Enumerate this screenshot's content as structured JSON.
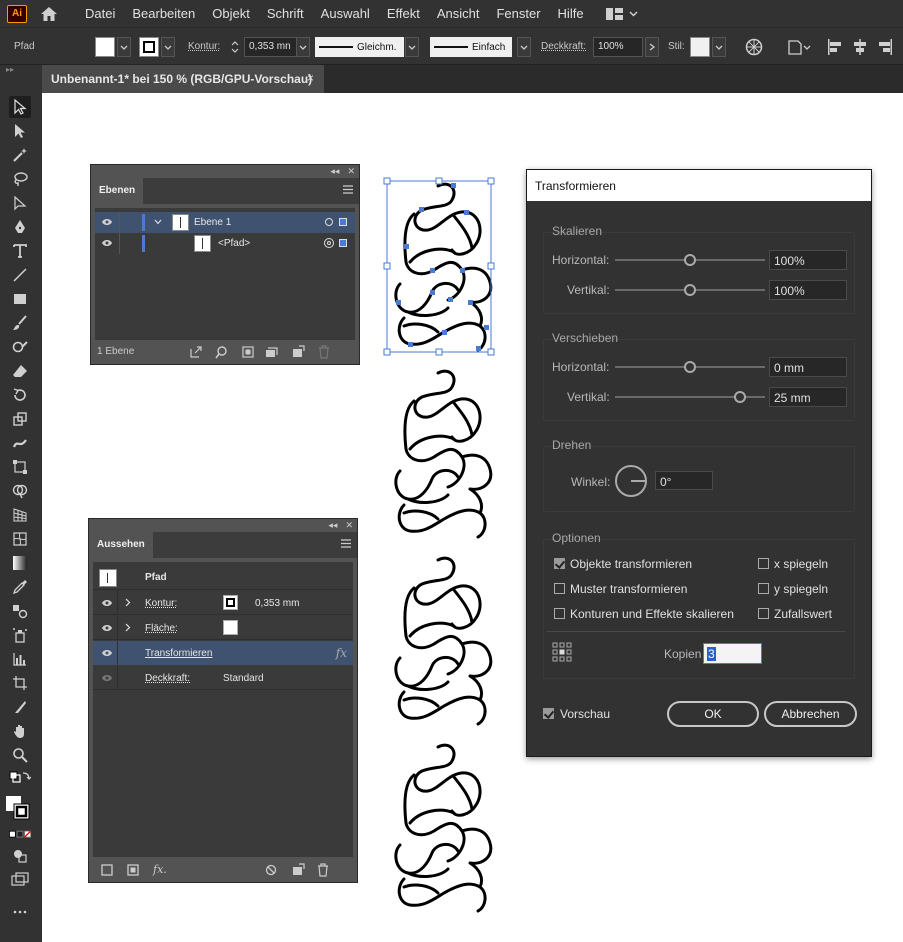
{
  "app": {
    "logo": "Ai"
  },
  "menu": [
    "Datei",
    "Bearbeiten",
    "Objekt",
    "Schrift",
    "Auswahl",
    "Effekt",
    "Ansicht",
    "Fenster",
    "Hilfe"
  ],
  "control": {
    "selection": "Pfad",
    "stroke_label": "Kontur:",
    "stroke_value": "0,353 mn",
    "profile": "Gleichm.",
    "brush": "Einfach",
    "opacity_label": "Deckkraft:",
    "opacity_value": "100%",
    "style_label": "Stil:"
  },
  "document": {
    "tab_title": "Unbenannt-1* bei 150 % (RGB/GPU-Vorschau)",
    "close": "×"
  },
  "layers_panel": {
    "tab": "Ebenen",
    "rows": [
      {
        "name": "Ebene 1"
      },
      {
        "name": "<Pfad>"
      }
    ],
    "footer": "1 Ebene"
  },
  "appearance_panel": {
    "tab": "Aussehen",
    "object": "Pfad",
    "rows": [
      {
        "label": "Kontur:",
        "value": "0,353 mm"
      },
      {
        "label": "Fläche:",
        "value": ""
      },
      {
        "label": "Transformieren",
        "value": "fx"
      },
      {
        "label": "Deckkraft:",
        "value": "Standard"
      }
    ],
    "footer_fx": "fx."
  },
  "dialog": {
    "title": "Transformieren",
    "scale": {
      "title": "Skalieren",
      "horizontal_label": "Horizontal:",
      "horizontal_value": "100%",
      "horizontal_pos": 0.5,
      "vertical_label": "Vertikal:",
      "vertical_value": "100%",
      "vertical_pos": 0.5
    },
    "move": {
      "title": "Verschieben",
      "horizontal_label": "Horizontal:",
      "horizontal_value": "0 mm",
      "horizontal_pos": 0.5,
      "vertical_label": "Vertikal:",
      "vertical_value": "25 mm",
      "vertical_pos": 0.83
    },
    "rotate": {
      "title": "Drehen",
      "angle_label": "Winkel:",
      "angle_value": "0°"
    },
    "options": {
      "title": "Optionen",
      "transform_objects": "Objekte transformieren",
      "transform_objects_checked": true,
      "transform_patterns": "Muster transformieren",
      "transform_patterns_checked": false,
      "scale_strokes": "Konturen und Effekte skalieren",
      "scale_strokes_checked": false,
      "reflect_x": "x spiegeln",
      "reflect_x_checked": false,
      "reflect_y": "y spiegeln",
      "reflect_y_checked": false,
      "random": "Zufallswert",
      "random_checked": false,
      "copies_label": "Kopien",
      "copies_value": "3"
    },
    "preview": "Vorschau",
    "preview_checked": true,
    "ok": "OK",
    "cancel": "Abbrechen"
  },
  "colors": {
    "accent": "#4a7bd1",
    "selection_row": "#3f5370",
    "canvas": "#ffffff",
    "anchor": "#4a7bd1"
  }
}
